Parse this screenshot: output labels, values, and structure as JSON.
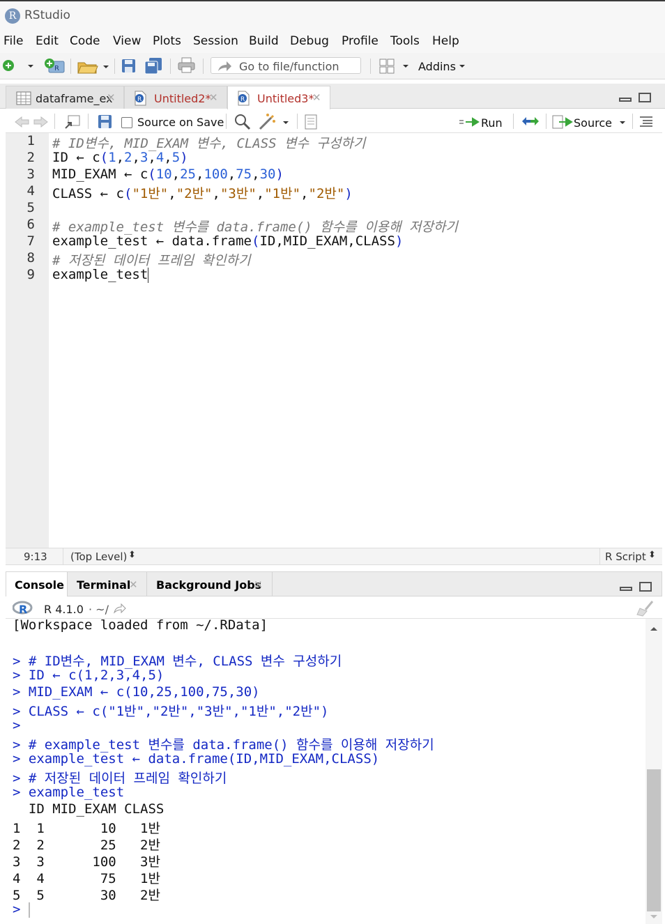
{
  "window": {
    "title": "RStudio",
    "logo_letter": "R"
  },
  "menubar": [
    "File",
    "Edit",
    "Code",
    "View",
    "Plots",
    "Session",
    "Build",
    "Debug",
    "Profile",
    "Tools",
    "Help"
  ],
  "toolbar": {
    "goto_placeholder": "Go to file/function",
    "addins_label": "Addins"
  },
  "editor_tabs": [
    {
      "label": "dataframe_ex",
      "type": "data",
      "active": false
    },
    {
      "label": "Untitled2*",
      "type": "r",
      "active": false
    },
    {
      "label": "Untitled3*",
      "type": "r",
      "active": true
    }
  ],
  "editor_toolbar": {
    "source_on_save": "Source on Save",
    "run_label": "Run",
    "source_label": "Source"
  },
  "editor": {
    "line_numbers": [
      "1",
      "2",
      "3",
      "4",
      "5",
      "6",
      "7",
      "8",
      "9"
    ],
    "lines": [
      [
        {
          "t": "# ID변수, MID_EXAM 변수, CLASS 변수 구성하기",
          "c": "cm"
        }
      ],
      [
        {
          "t": "ID ",
          "c": ""
        },
        {
          "t": "←",
          "c": ""
        },
        {
          "t": " c",
          "c": ""
        },
        {
          "t": "(",
          "c": "par"
        },
        {
          "t": "1",
          "c": "num"
        },
        {
          "t": ",",
          "c": ""
        },
        {
          "t": "2",
          "c": "num"
        },
        {
          "t": ",",
          "c": ""
        },
        {
          "t": "3",
          "c": "num"
        },
        {
          "t": ",",
          "c": ""
        },
        {
          "t": "4",
          "c": "num"
        },
        {
          "t": ",",
          "c": ""
        },
        {
          "t": "5",
          "c": "num"
        },
        {
          "t": ")",
          "c": "par"
        }
      ],
      [
        {
          "t": "MID_EXAM ",
          "c": ""
        },
        {
          "t": "←",
          "c": ""
        },
        {
          "t": " c",
          "c": ""
        },
        {
          "t": "(",
          "c": "par"
        },
        {
          "t": "10",
          "c": "num"
        },
        {
          "t": ",",
          "c": ""
        },
        {
          "t": "25",
          "c": "num"
        },
        {
          "t": ",",
          "c": ""
        },
        {
          "t": "100",
          "c": "num"
        },
        {
          "t": ",",
          "c": ""
        },
        {
          "t": "75",
          "c": "num"
        },
        {
          "t": ",",
          "c": ""
        },
        {
          "t": "30",
          "c": "num"
        },
        {
          "t": ")",
          "c": "par"
        }
      ],
      [
        {
          "t": "CLASS ",
          "c": ""
        },
        {
          "t": "←",
          "c": ""
        },
        {
          "t": " c",
          "c": ""
        },
        {
          "t": "(",
          "c": "par"
        },
        {
          "t": "\"1반\"",
          "c": "str"
        },
        {
          "t": ",",
          "c": ""
        },
        {
          "t": "\"2반\"",
          "c": "str"
        },
        {
          "t": ",",
          "c": ""
        },
        {
          "t": "\"3반\"",
          "c": "str"
        },
        {
          "t": ",",
          "c": ""
        },
        {
          "t": "\"1반\"",
          "c": "str"
        },
        {
          "t": ",",
          "c": ""
        },
        {
          "t": "\"2반\"",
          "c": "str"
        },
        {
          "t": ")",
          "c": "par"
        }
      ],
      [],
      [
        {
          "t": "# example_test 변수를 data.frame() 함수를 이용해 저장하기",
          "c": "cm"
        }
      ],
      [
        {
          "t": "example_test ",
          "c": ""
        },
        {
          "t": "←",
          "c": ""
        },
        {
          "t": " data.frame",
          "c": ""
        },
        {
          "t": "(",
          "c": "par"
        },
        {
          "t": "ID,MID_EXAM,CLASS",
          "c": ""
        },
        {
          "t": ")",
          "c": "par"
        }
      ],
      [
        {
          "t": "# 저장된 데이터 프레임 확인하기",
          "c": "cm"
        }
      ],
      [
        {
          "t": "example_test",
          "c": ""
        }
      ]
    ]
  },
  "statusbar": {
    "position": "9:13",
    "scope": "(Top Level)",
    "filetype": "R Script"
  },
  "console_tabs": [
    {
      "label": "Console",
      "active": true,
      "closable": false
    },
    {
      "label": "Terminal",
      "active": false,
      "closable": true
    },
    {
      "label": "Background Jobs",
      "active": false,
      "closable": true
    }
  ],
  "console_header": {
    "version": "R 4.1.0",
    "dir": "· ~/"
  },
  "console": [
    {
      "t": "[Workspace loaded from ~/.RData]",
      "k": "out"
    },
    {
      "t": "",
      "k": "out"
    },
    {
      "t": "> # ID변수, MID_EXAM 변수, CLASS 변수 구성하기",
      "k": "in"
    },
    {
      "t": "> ID ← c(1,2,3,4,5)",
      "k": "in"
    },
    {
      "t": "> MID_EXAM ← c(10,25,100,75,30)",
      "k": "in"
    },
    {
      "t": "> CLASS ← c(\"1반\",\"2반\",\"3반\",\"1반\",\"2반\")",
      "k": "in"
    },
    {
      "t": ">",
      "k": "in"
    },
    {
      "t": "> # example_test 변수를 data.frame() 함수를 이용해 저장하기",
      "k": "in"
    },
    {
      "t": "> example_test ← data.frame(ID,MID_EXAM,CLASS)",
      "k": "in"
    },
    {
      "t": "> # 저장된 데이터 프레임 확인하기",
      "k": "in"
    },
    {
      "t": "> example_test",
      "k": "in"
    },
    {
      "t": "  ID MID_EXAM CLASS",
      "k": "out"
    },
    {
      "t": "1  1       10   1반",
      "k": "out"
    },
    {
      "t": "2  2       25   2반",
      "k": "out"
    },
    {
      "t": "3  3      100   3반",
      "k": "out"
    },
    {
      "t": "4  4       75   1반",
      "k": "out"
    },
    {
      "t": "5  5       30   2반",
      "k": "out"
    },
    {
      "t": "> ",
      "k": "in"
    }
  ],
  "colors": {
    "accent_blue": "#1428c4",
    "number_blue": "#2a5fd6",
    "string_orange": "#a05a00",
    "comment_gray": "#777777",
    "tab_modified_red": "#b2302a"
  }
}
